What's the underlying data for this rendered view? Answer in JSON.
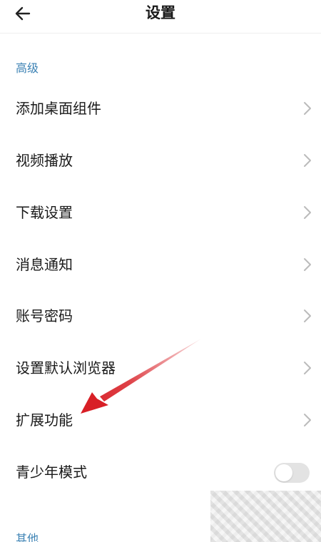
{
  "header": {
    "title": "设置",
    "back_icon": "arrow-left-icon"
  },
  "sections": {
    "advanced": {
      "label": "高级"
    },
    "other": {
      "label": "其他"
    }
  },
  "items": [
    {
      "label": "添加桌面组件",
      "icon": "chevron-right-icon"
    },
    {
      "label": "视频播放",
      "icon": "chevron-right-icon"
    },
    {
      "label": "下载设置",
      "icon": "chevron-right-icon"
    },
    {
      "label": "消息通知",
      "icon": "chevron-right-icon"
    },
    {
      "label": "账号密码",
      "icon": "chevron-right-icon"
    },
    {
      "label": "设置默认浏览器",
      "icon": "chevron-right-icon"
    },
    {
      "label": "扩展功能",
      "icon": "chevron-right-icon"
    }
  ],
  "teen_mode": {
    "label": "青少年模式",
    "enabled": false
  },
  "colors": {
    "section_label": "#3c82b4",
    "annotation_arrow": "#d81f26",
    "toggle_off": "#e3e3e3",
    "chevron": "#bbbbbb"
  }
}
